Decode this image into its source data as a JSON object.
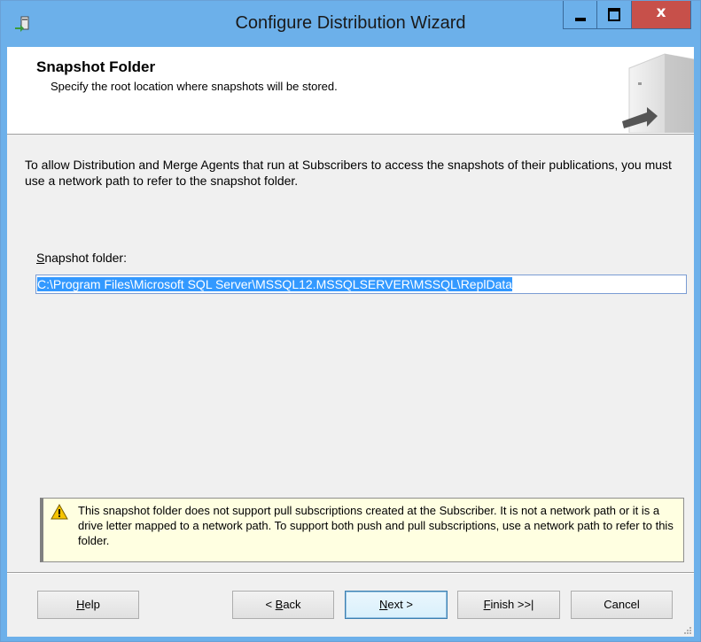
{
  "window": {
    "title": "Configure Distribution Wizard",
    "close_glyph": "x",
    "title_bar_color": "#6cb0ea",
    "close_color": "#c7504a"
  },
  "header": {
    "title": "Snapshot Folder",
    "subtitle": "Specify the root location where snapshots will be stored."
  },
  "intro_text": "To allow Distribution and Merge Agents that run at Subscribers to access the snapshots of their publications, you must use a network path to refer to the snapshot folder.",
  "snapshot_folder": {
    "label_prefix": "S",
    "label_rest": "napshot folder:",
    "value": "C:\\Program Files\\Microsoft SQL Server\\MSSQL12.MSSQLSERVER\\MSSQL\\ReplData"
  },
  "warning": {
    "icon": "warning-icon",
    "text": "This snapshot folder does not support pull subscriptions created at the Subscriber. It is not a network path or it is a drive letter mapped to a network path. To support both push and pull subscriptions, use a network path to refer to this folder."
  },
  "buttons": {
    "help_key": "H",
    "help_rest": "elp",
    "back_pre": "< ",
    "back_key": "B",
    "back_rest": "ack",
    "next_key": "N",
    "next_rest": "ext >",
    "finish_key": "F",
    "finish_rest": "inish >>|",
    "cancel": "Cancel"
  }
}
